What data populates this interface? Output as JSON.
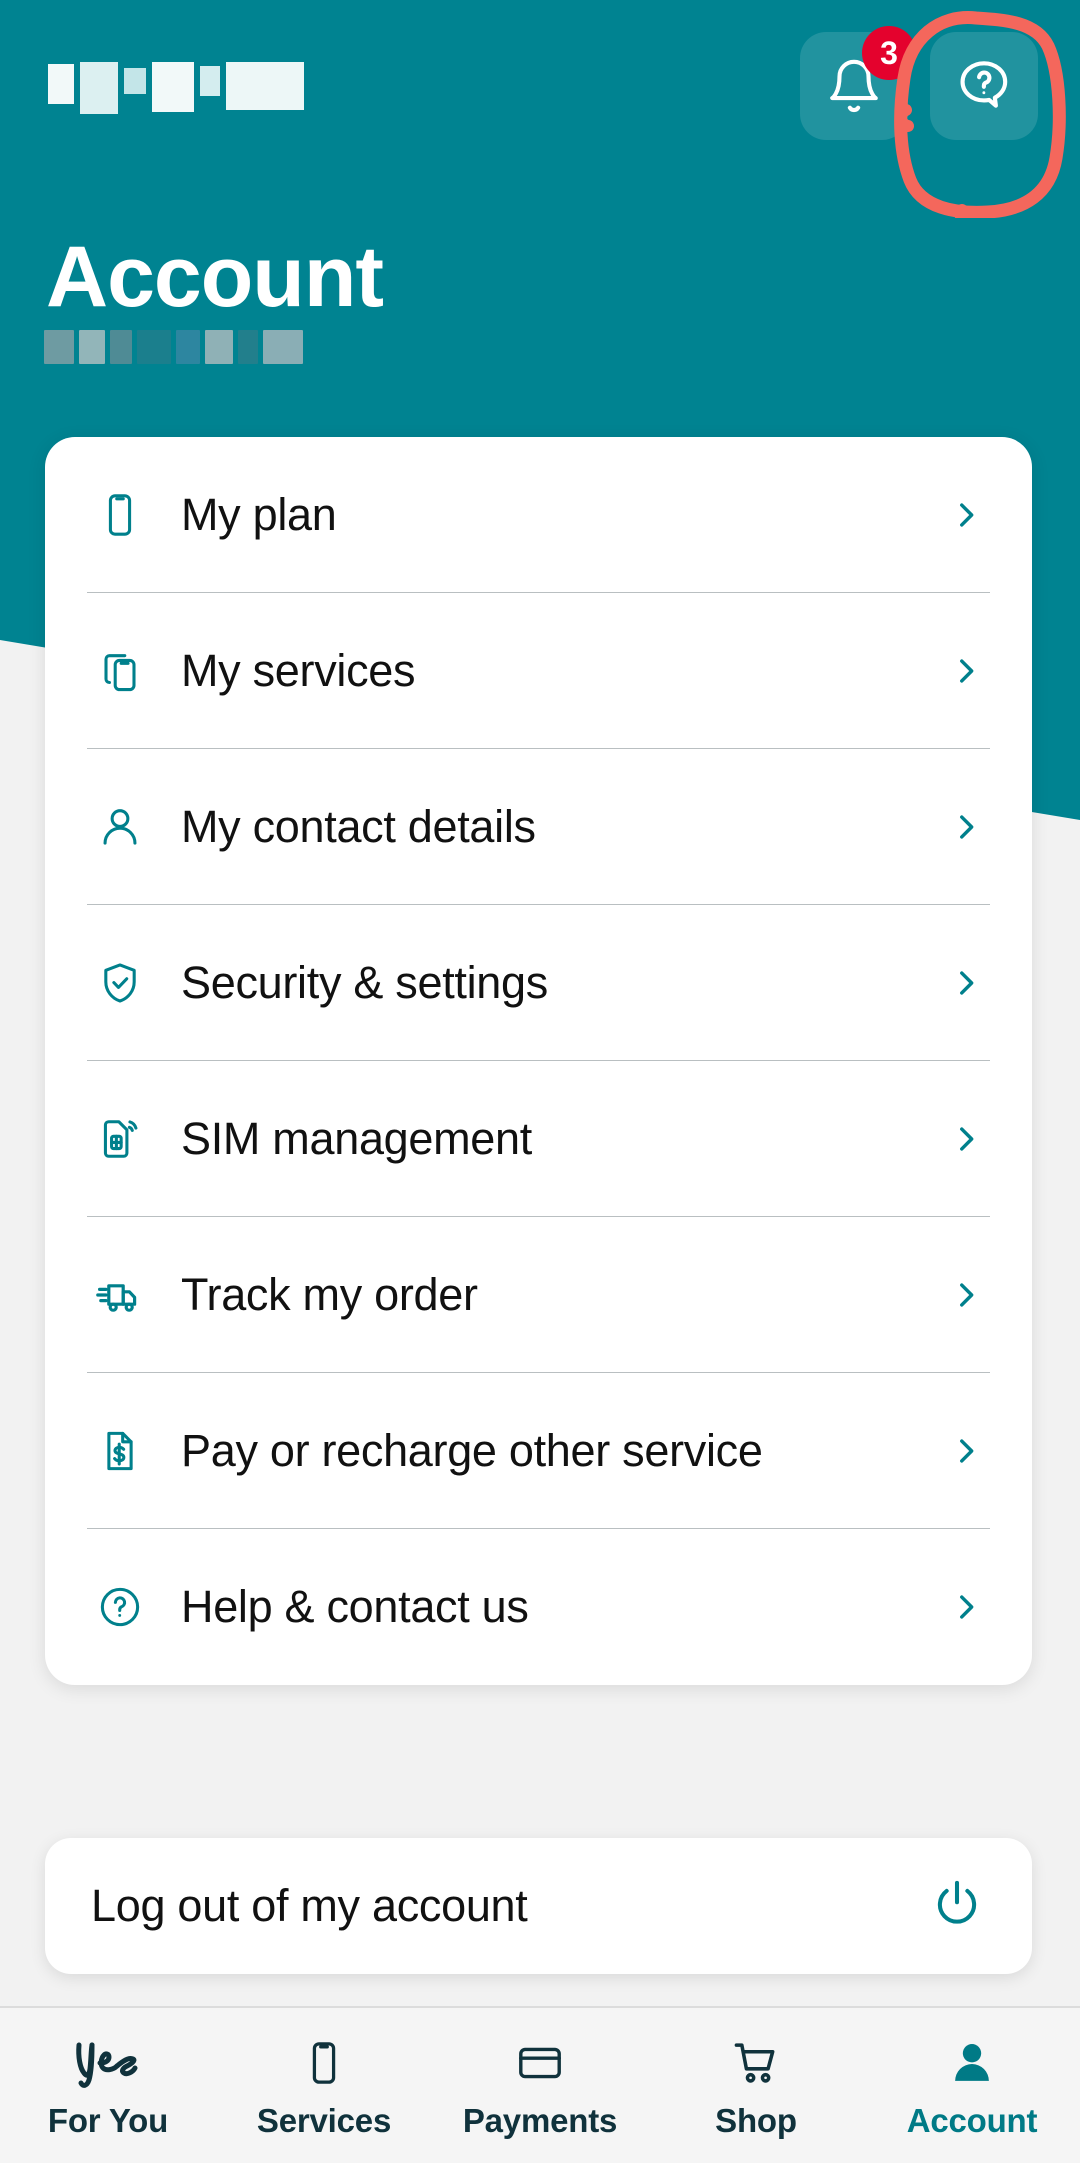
{
  "app": {
    "brand_teal": "#008391",
    "accent_teal": "#007A86",
    "nav_dark": "#10323C",
    "badge_red": "#E4022D",
    "annotation_red": "#F4675C"
  },
  "header": {
    "title": "Account",
    "greeting_redacted": true,
    "subtitle_redacted": true,
    "notifications": {
      "icon": "bell-icon",
      "badge_count": "3"
    },
    "help": {
      "icon": "help-question-bubble-icon",
      "annotated": true,
      "annotation_shape": "hand-drawn-red-oval"
    }
  },
  "menu": {
    "items": [
      {
        "label": "My plan",
        "icon": "phone-icon",
        "chevron": "chevron-right-icon"
      },
      {
        "label": "My services",
        "icon": "two-phones-icon",
        "chevron": "chevron-right-icon"
      },
      {
        "label": "My contact details",
        "icon": "person-icon",
        "chevron": "chevron-right-icon"
      },
      {
        "label": "Security & settings",
        "icon": "shield-check-icon",
        "chevron": "chevron-right-icon"
      },
      {
        "label": "SIM management",
        "icon": "sim-card-signal-icon",
        "chevron": "chevron-right-icon"
      },
      {
        "label": "Track my order",
        "icon": "delivery-truck-icon",
        "chevron": "chevron-right-icon"
      },
      {
        "label": "Pay or recharge other service",
        "icon": "document-dollar-icon",
        "chevron": "chevron-right-icon"
      },
      {
        "label": "Help & contact us",
        "icon": "question-circle-icon",
        "chevron": "chevron-right-icon"
      }
    ]
  },
  "logout": {
    "label": "Log out of my account",
    "icon": "power-icon"
  },
  "bottom_nav": {
    "items": [
      {
        "label": "For You",
        "icon": "yes-script-logo-icon",
        "active": false
      },
      {
        "label": "Services",
        "icon": "phone-icon",
        "active": false
      },
      {
        "label": "Payments",
        "icon": "credit-card-icon",
        "active": false
      },
      {
        "label": "Shop",
        "icon": "shopping-cart-icon",
        "active": false
      },
      {
        "label": "Account",
        "icon": "person-filled-icon",
        "active": true
      }
    ]
  }
}
